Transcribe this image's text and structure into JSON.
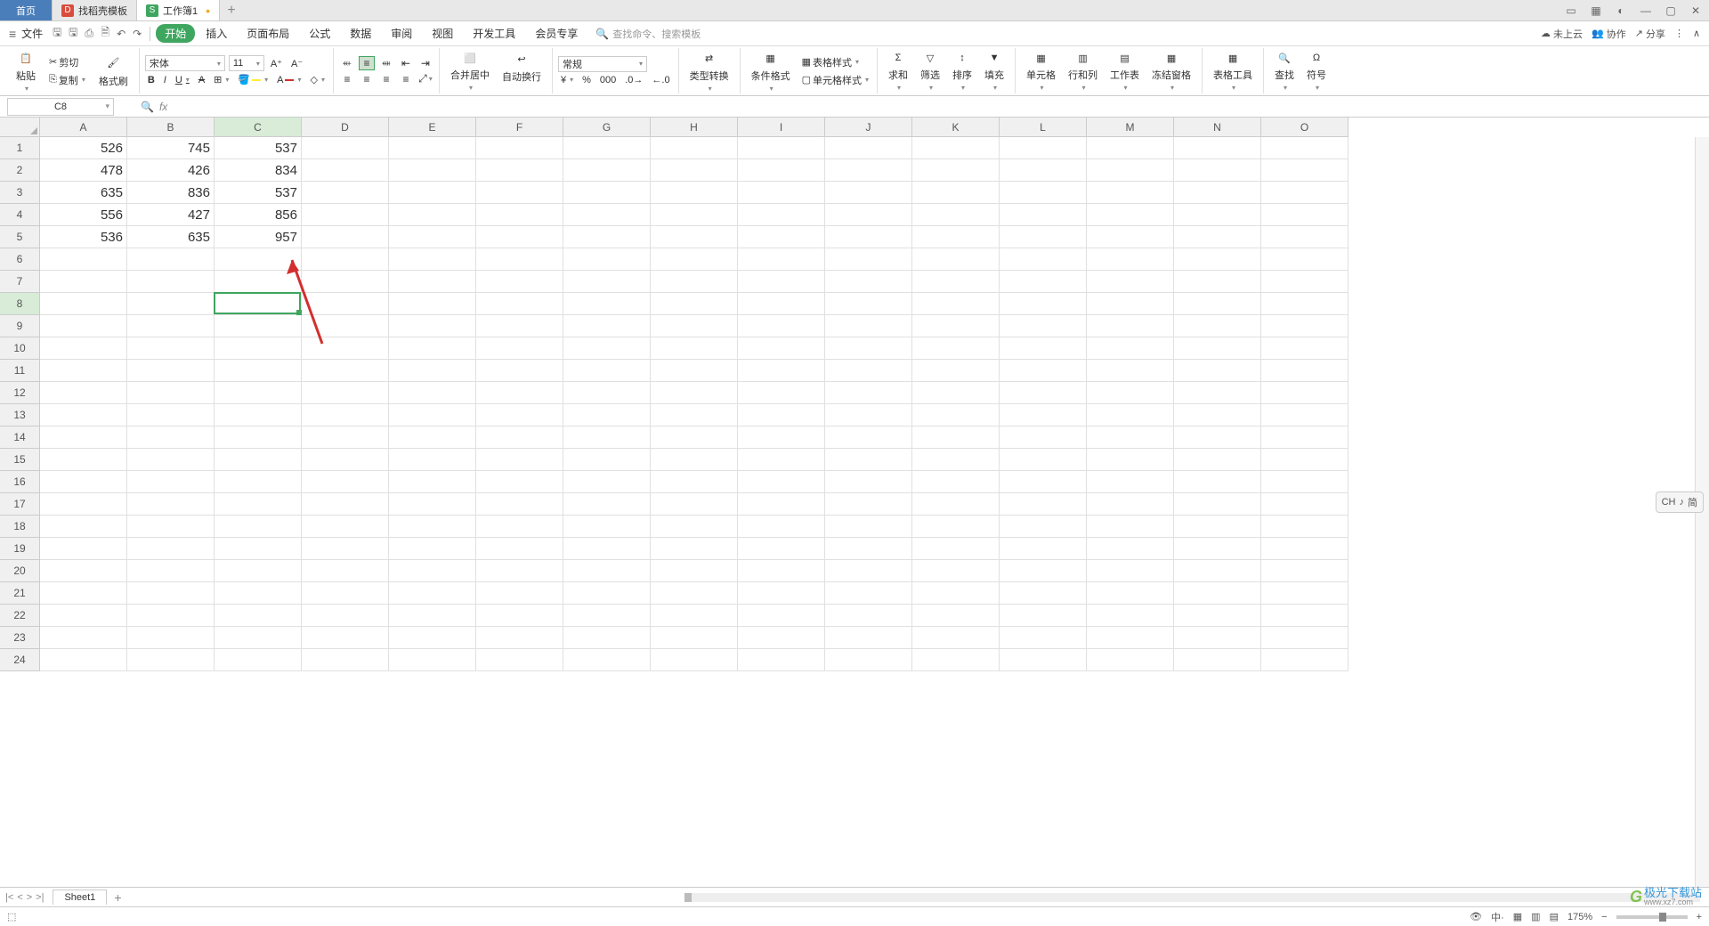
{
  "titlebar": {
    "home_tab": "首页",
    "template_tab": "找稻壳模板",
    "workbook_tab": "工作簿1"
  },
  "menubar": {
    "file": "文件",
    "tabs": [
      "开始",
      "插入",
      "页面布局",
      "公式",
      "数据",
      "审阅",
      "视图",
      "开发工具",
      "会员专享"
    ],
    "search_placeholder": "查找命令、搜索模板",
    "cloud": "未上云",
    "collab": "协作",
    "share": "分享"
  },
  "ribbon": {
    "paste": "粘贴",
    "cut": "剪切",
    "copy": "复制",
    "format_painter": "格式刷",
    "font_name": "宋体",
    "font_size": "11",
    "merge": "合并居中",
    "wrap": "自动换行",
    "number_format": "常规",
    "type_convert": "类型转换",
    "cond_format": "条件格式",
    "table_style": "表格样式",
    "cell_style": "单元格样式",
    "sum": "求和",
    "filter": "筛选",
    "sort": "排序",
    "fill": "填充",
    "cell": "单元格",
    "rowcol": "行和列",
    "sheet": "工作表",
    "freeze": "冻结窗格",
    "table_tools": "表格工具",
    "find": "查找",
    "symbol": "符号"
  },
  "formula": {
    "name_box": "C8"
  },
  "grid": {
    "columns": [
      "A",
      "B",
      "C",
      "D",
      "E",
      "F",
      "G",
      "H",
      "I",
      "J",
      "K",
      "L",
      "M",
      "N",
      "O"
    ],
    "row_count": 24,
    "selected_col": "C",
    "selected_row": 8,
    "data": [
      [
        "526",
        "745",
        "537"
      ],
      [
        "478",
        "426",
        "834"
      ],
      [
        "635",
        "836",
        "537"
      ],
      [
        "556",
        "427",
        "856"
      ],
      [
        "536",
        "635",
        "957"
      ]
    ]
  },
  "sheet": {
    "name": "Sheet1"
  },
  "status": {
    "zoom": "175%",
    "ime": "CH",
    "ime2": "简"
  },
  "watermark": {
    "brand": "极光下载站",
    "url": "www.xz7.com"
  }
}
